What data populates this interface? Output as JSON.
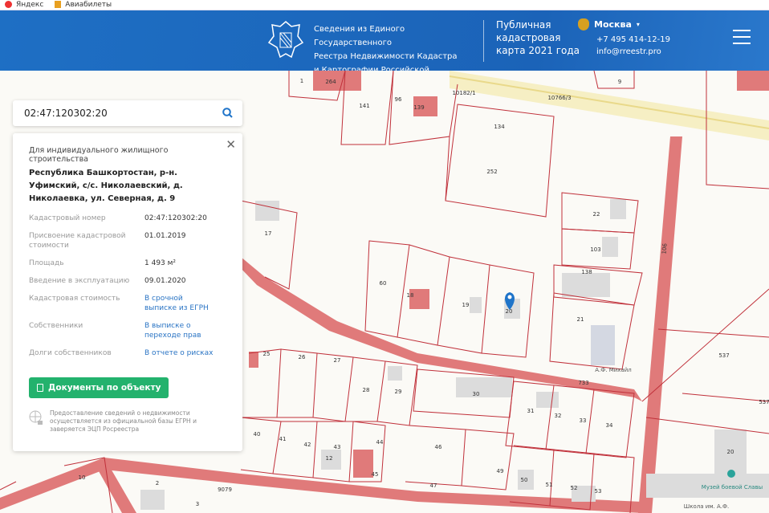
{
  "bookmarks": [
    {
      "label": "Яндекс"
    },
    {
      "label": "Авиабилеты"
    }
  ],
  "header": {
    "org_line1": "Сведения из Единого Государственного",
    "org_line2": "Реестра Недвижимости Кадастра",
    "org_line3": "и Картографии Российской Федерации",
    "product_line1": "Публичная",
    "product_line2": "кадастровая",
    "product_line3": "карта 2021 года",
    "city": "Москва",
    "phone": "+7 495 414-12-19",
    "email": "info@rreestr.pro"
  },
  "search": {
    "value": "02:47:120302:20"
  },
  "card": {
    "purpose": "Для индивидуального жилищного строительства",
    "address": "Республика Башкортостан, р-н. Уфимский, с/с. Николаевский, д. Николаевка, ул. Северная, д. 9",
    "rows": [
      {
        "key": "Кадастровый номер",
        "value": "02:47:120302:20"
      },
      {
        "key": "Присвоение кадастровой стоимости",
        "value": "01.01.2019"
      },
      {
        "key": "Площадь",
        "value": "1 493 м²"
      },
      {
        "key": "Введение в эксплуатацию",
        "value": "09.01.2020"
      },
      {
        "key": "Кадастровая стоимость",
        "value": "В срочной выписке из ЕГРН"
      },
      {
        "key": "Собственники",
        "value": "В выписке о переходе прав"
      },
      {
        "key": "Долги собственников",
        "value": "В отчете о рисках"
      }
    ],
    "button": "Документы по объекту",
    "note": "Предоставление сведений о недвижимости осуществляется из официальной базы ЕГРН и заверяется ЭЦП Росреестра"
  },
  "map": {
    "lots": [
      "1",
      "264",
      "141",
      "96",
      "139",
      "10182/1",
      "10766/3",
      "9",
      "134",
      "252",
      "22",
      "103",
      "138",
      "21",
      "17",
      "60",
      "18",
      "19",
      "20",
      "537",
      "25",
      "26",
      "27",
      "28",
      "29",
      "30",
      "31",
      "32",
      "33",
      "34",
      "40",
      "41",
      "42",
      "43",
      "44",
      "12",
      "46",
      "45",
      "47",
      "49",
      "50",
      "51",
      "52",
      "53",
      "10",
      "2",
      "3",
      "20",
      "537",
      "733",
      "9079",
      "106"
    ],
    "pois": [
      "А.Ф. Михайл",
      "Музей боевой Славы",
      "Школа им. А.Ф."
    ]
  },
  "colors": {
    "header": "#1b63b8",
    "road": "#e07a7a",
    "parcel": "#c0303a",
    "button": "#23b26d",
    "link": "#2a74c4"
  }
}
